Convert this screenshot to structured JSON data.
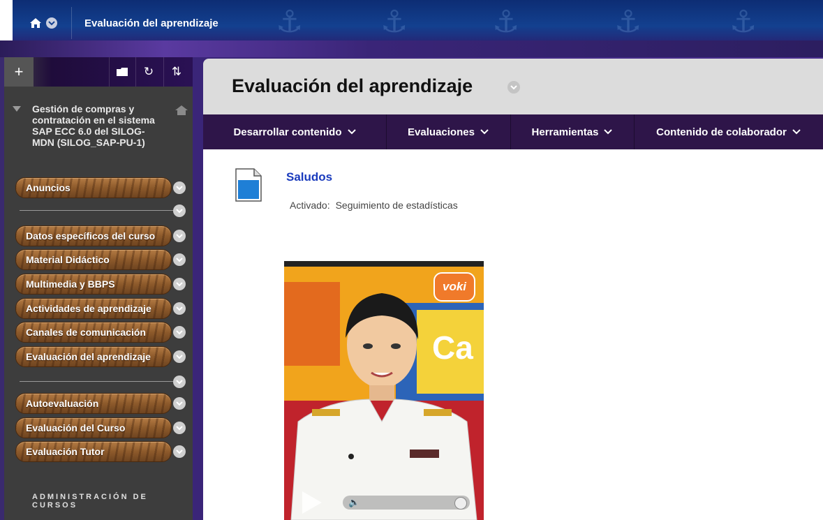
{
  "breadcrumb": {
    "title": "Evaluación del aprendizaje"
  },
  "sidebar": {
    "course_title": "Gestión de compras y contratación en el sistema SAP ECC 6.0 del SILOG-MDN (SILOG_SAP-PU-1)",
    "items": [
      {
        "label": "Anuncios"
      },
      {
        "label": "Datos específicos del curso"
      },
      {
        "label": "Material Didáctico"
      },
      {
        "label": "Multimedia y BBPS"
      },
      {
        "label": "Actividades de aprendizaje"
      },
      {
        "label": "Canales de comunicación"
      },
      {
        "label": "Evaluación del aprendizaje"
      },
      {
        "label": "Autoevaluación"
      },
      {
        "label": "Evaluación del Curso"
      },
      {
        "label": "Evaluación Tutor"
      }
    ],
    "admin_title": "ADMINISTRACIÓN DE CURSOS"
  },
  "page": {
    "title": "Evaluación del aprendizaje"
  },
  "menu": {
    "items": [
      {
        "label": "Desarrollar contenido"
      },
      {
        "label": "Evaluaciones"
      },
      {
        "label": "Herramientas"
      },
      {
        "label": "Contenido de colaborador"
      }
    ]
  },
  "content": {
    "item_title": "Saludos",
    "meta_label": "Activado:",
    "meta_value": "Seguimiento de estadísticas",
    "voki_logo": "voki",
    "voki_sign": "Ca"
  },
  "colors": {
    "menu_bg": "#2e1549",
    "link": "#1a3bbd",
    "title_bar": "#dcdcdc"
  },
  "icons": {
    "home": "home-icon",
    "add": "plus-icon",
    "folder": "folder-icon",
    "refresh": "refresh-icon",
    "sort": "sort-icon",
    "chevron": "chevron-down-icon",
    "document": "document-icon"
  }
}
